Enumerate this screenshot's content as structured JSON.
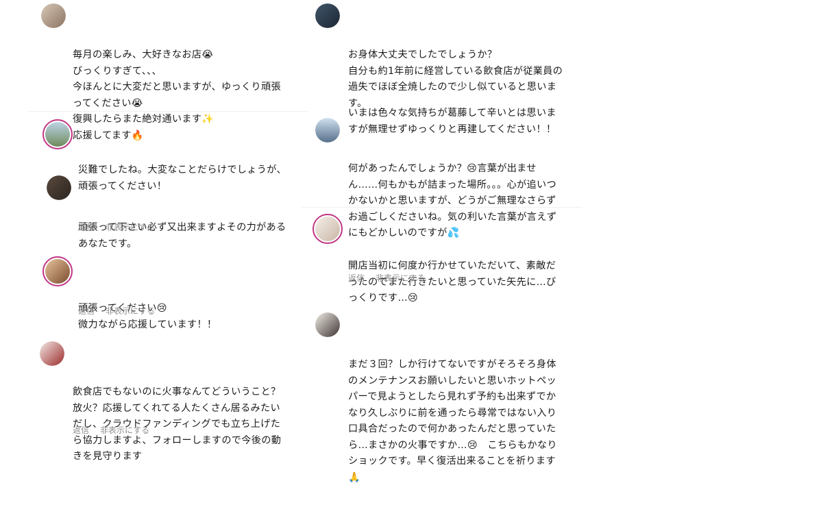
{
  "comments": [
    {
      "lines": [
        "毎月の楽しみ、大好きなお店😭",
        "びっくりすぎて、、、",
        "今ほんとに大変だと思いますが、ゆっくり頑張",
        "ってください😭",
        "復興したらまた絶対通います✨",
        "応援してます🔥"
      ]
    },
    {
      "lines": [
        "災難でしたね。大変なことだらけでしょうが、",
        "頑張ってください！"
      ]
    },
    {
      "lines": [
        "頑張って下さい必ず又出来ますよその力がある",
        "あなたです。"
      ]
    },
    {
      "lines": [
        "頑張ってください😢",
        "微力ながら応援しています！！"
      ]
    },
    {
      "lines": [
        "飲食店でもないのに火事なんてどういうこと？",
        "放火？応援してくれてる人たくさん居るみたい",
        "だし、クラウドファンディングでも立ち上げた",
        "ら協力しますよ、フォローしますので今後の動",
        "きを見守ります"
      ]
    },
    {
      "lines": [
        "お身体大丈夫でしたでしょうか？",
        "自分も約1年前に経営している飲食店が従業員の",
        "過失でほぼ全焼したので少し似ていると思いま",
        "す。"
      ]
    },
    {
      "lines": [
        "何があったんでしょうか？😢言葉が出ませ",
        "ん……何もかもが詰まった場所。。。心が追いつ",
        "かないかと思いますが、どうがご無理なさらず",
        "お過ごしくださいね。気の利いた言葉が言えず",
        "にもどかしいのですが💦"
      ]
    },
    {
      "lines": [
        "開店当初に何度か行かせていただいて、素敵だ",
        "ったのでまた行きたいと思っていた矢先に…び",
        "っくりです…😢"
      ]
    },
    {
      "lines": [
        "まだ３回？しか行けてないですがそろそろ身体",
        "のメンテナンスお願いしたいと思いホットペッ",
        "パーで見ようとしたら見れず予約も出来ずでか",
        "なり久しぶりに前を通ったら尋常ではない入り",
        "口具合だったので何かあったんだと思っていた",
        "ら…まさかの火事ですか…😢　こちらもかなり",
        "ショックです。早く復活出来ることを祈ります",
        "🙏"
      ]
    }
  ],
  "extra": {
    "lines": [
      "いまは色々な気持ちが葛藤して辛いとは思いま",
      "すが無理せずゆっくりと再建してください！！"
    ]
  },
  "actions": {
    "reply": "返信",
    "hide": "非表示にする"
  }
}
